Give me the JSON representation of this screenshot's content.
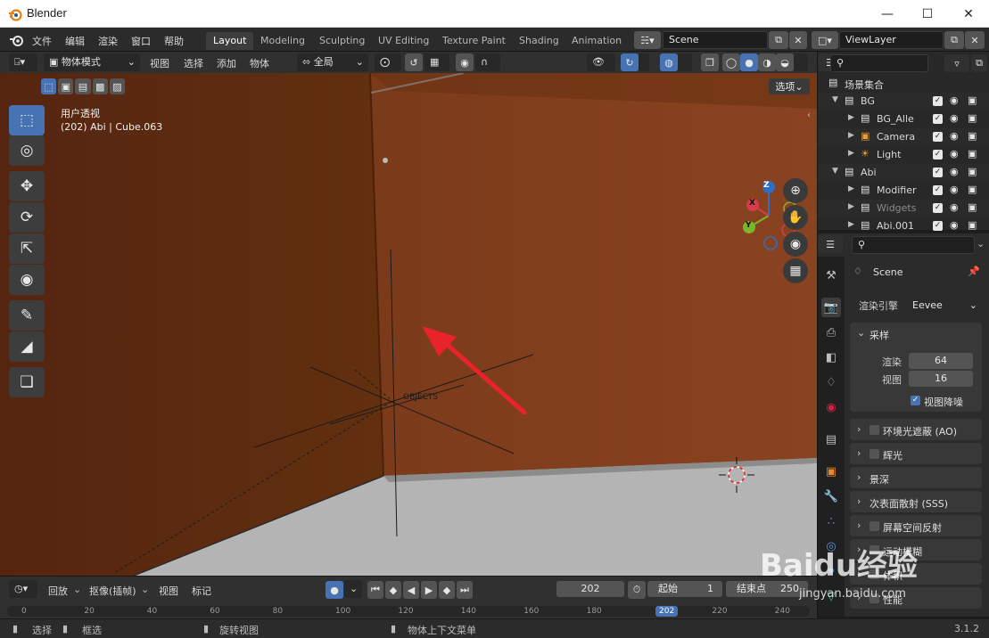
{
  "window": {
    "title": "Blender"
  },
  "menu": {
    "items": [
      "文件",
      "编辑",
      "渲染",
      "窗口",
      "帮助"
    ]
  },
  "workspaces": {
    "active": "Layout",
    "tabs": [
      "Layout",
      "Modeling",
      "Sculpting",
      "UV Editing",
      "Texture Paint",
      "Shading",
      "Animation"
    ]
  },
  "scene": {
    "name": "Scene"
  },
  "view_layer": {
    "name": "ViewLayer"
  },
  "viewport": {
    "mode": "物体模式",
    "menus": [
      "视图",
      "选择",
      "添加",
      "物体"
    ],
    "orientation": "全局",
    "options_label": "选项",
    "overlay_title": "用户透视",
    "overlay_object": "(202) Abi | Cube.063",
    "empty_label": "OBJECTS",
    "gizmo": {
      "x": "X",
      "y": "Y",
      "z": "Z"
    }
  },
  "outliner": {
    "rows": [
      {
        "label": "场景集合",
        "indent": 0
      },
      {
        "label": "BG",
        "indent": 1
      },
      {
        "label": "BG_Alle",
        "indent": 2
      },
      {
        "label": "Camera",
        "indent": 2
      },
      {
        "label": "Light",
        "indent": 2
      },
      {
        "label": "Abi",
        "indent": 1
      },
      {
        "label": "Modifier",
        "indent": 2
      },
      {
        "label": "Widgets",
        "indent": 2
      },
      {
        "label": "Abi.001",
        "indent": 2
      }
    ]
  },
  "properties": {
    "context": "Scene",
    "render_engine_label": "渲染引擎",
    "render_engine": "Eevee",
    "sampling": {
      "title": "采样",
      "render_label": "渲染",
      "render_value": "64",
      "viewport_label": "视图",
      "viewport_value": "16",
      "denoise_label": "视图降噪"
    },
    "panels": [
      "环境光遮蔽 (AO)",
      "辉光",
      "景深",
      "次表面散射 (SSS)",
      "屏幕空间反射",
      "运动模糊",
      "体积",
      "性能"
    ]
  },
  "timeline": {
    "menus": [
      "回放",
      "抠像(插帧)",
      "视图",
      "标记"
    ],
    "current_frame": "202",
    "start_label": "起始",
    "start_value": "1",
    "end_label": "结束点",
    "end_value": "250",
    "ruler": [
      "0",
      "20",
      "40",
      "60",
      "80",
      "100",
      "120",
      "140",
      "160",
      "180",
      "202",
      "220",
      "240"
    ]
  },
  "status": {
    "select": "选择",
    "box_select": "框选",
    "rotate_view": "旋转视图",
    "context_menu": "物体上下文菜单",
    "version": "3.1.2"
  },
  "watermark": {
    "text": "Baidu经验",
    "sub": "jingyan.baidu.com"
  },
  "colors": {
    "accent": "#4772b3",
    "wall": "#7a3a17",
    "floor": "#b4b4b4",
    "arrow": "#e8232a"
  }
}
